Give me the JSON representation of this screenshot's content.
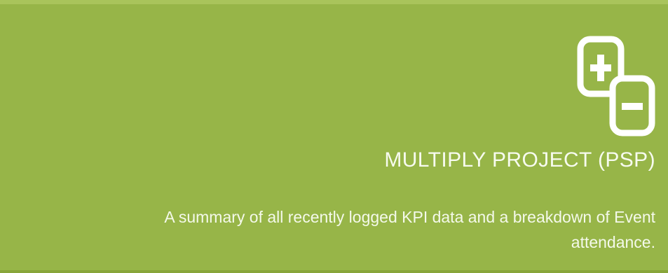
{
  "card": {
    "icon": "plus-minus-squares-icon",
    "title": "MULTIPLY PROJECT (PSP)",
    "description": "A summary of all recently logged KPI data and a breakdown of Event attendance."
  },
  "colors": {
    "background": "#97b548",
    "text": "#ffffff"
  }
}
